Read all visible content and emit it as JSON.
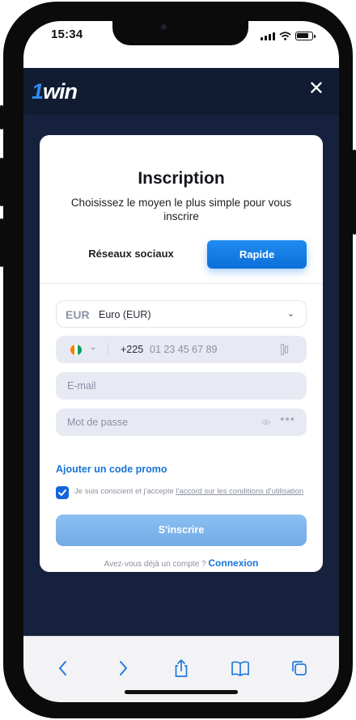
{
  "status_bar": {
    "time": "15:34"
  },
  "app": {
    "logo_prefix": "1",
    "logo_suffix": "win"
  },
  "modal": {
    "title": "Inscription",
    "subtitle": "Choisissez le moyen le plus simple pour vous inscrire",
    "tabs": [
      {
        "label": "Réseaux sociaux",
        "active": false
      },
      {
        "label": "Rapide",
        "active": true
      }
    ],
    "currency": {
      "code": "EUR",
      "name": "Euro (EUR)"
    },
    "phone": {
      "prefix": "+225",
      "placeholder": "01 23 45 67 89",
      "flag_colors": [
        "#f77f00",
        "#ffffff",
        "#009e60"
      ]
    },
    "email": {
      "placeholder": "E-mail"
    },
    "password": {
      "placeholder": "Mot de passe"
    },
    "promo_link": "Ajouter un code promo",
    "terms": {
      "checked": true,
      "text": "Je suis conscient et j'accepte",
      "link": "l'accord sur les conditions d'utilisation"
    },
    "submit_label": "S'inscrire",
    "login_prompt": "Avez-vous déjà un compte ?",
    "login_link": "Connexion"
  },
  "colors": {
    "accent": "#1874d9",
    "header_bg": "#111c33",
    "submit_bg": "#7fb6ec"
  },
  "toolbar_icons": [
    "back-icon",
    "forward-icon",
    "share-icon",
    "bookmarks-icon",
    "tabs-icon"
  ]
}
